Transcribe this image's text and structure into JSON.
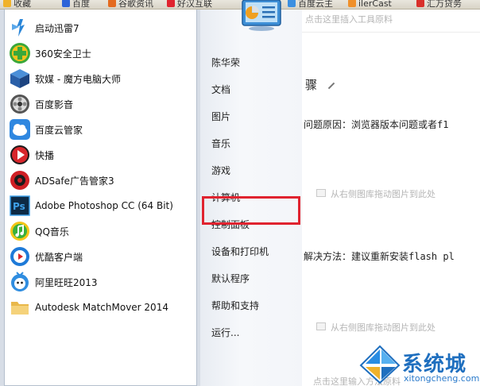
{
  "favorites_bar": {
    "items": [
      {
        "label": "收藏",
        "icon": "star-icon"
      },
      {
        "label": "百度",
        "icon": "baidu-icon"
      },
      {
        "label": "谷歌资讯",
        "icon": "news-icon"
      },
      {
        "label": "好汉互联",
        "icon": "web-icon"
      },
      {
        "label": "百度云主",
        "icon": "cloud-icon"
      },
      {
        "label": "ilerCast",
        "icon": "cast-icon"
      },
      {
        "label": "汇万贷务",
        "icon": "finance-icon"
      }
    ]
  },
  "start_menu": {
    "programs": [
      {
        "label": "启动迅雷7",
        "icon": "thunder-icon"
      },
      {
        "label": "360安全卫士",
        "icon": "360-safe-icon"
      },
      {
        "label": "软媒 - 魔方电脑大师",
        "icon": "rubik-cube-icon"
      },
      {
        "label": "百度影音",
        "icon": "baidu-player-icon"
      },
      {
        "label": "百度云管家",
        "icon": "baidu-cloud-icon"
      },
      {
        "label": "快播",
        "icon": "qvod-icon"
      },
      {
        "label": "ADSafe广告管家3",
        "icon": "adsafe-icon"
      },
      {
        "label": "Adobe Photoshop CC (64 Bit)",
        "icon": "photoshop-icon"
      },
      {
        "label": "QQ音乐",
        "icon": "qq-music-icon"
      },
      {
        "label": "优酷客户端",
        "icon": "youku-icon"
      },
      {
        "label": "阿里旺旺2013",
        "icon": "aliwangwang-icon"
      },
      {
        "label": "Autodesk MatchMover 2014",
        "icon": "folder-icon"
      }
    ],
    "right_items": [
      {
        "label": "陈华荣"
      },
      {
        "label": "文档"
      },
      {
        "label": "图片"
      },
      {
        "label": "音乐"
      },
      {
        "label": "游戏"
      },
      {
        "label": "计算机"
      },
      {
        "label": "控制面板"
      },
      {
        "label": "设备和打印机"
      },
      {
        "label": "默认程序"
      },
      {
        "label": "帮助和支持"
      },
      {
        "label": "运行..."
      }
    ],
    "highlighted_item": "控制面板",
    "highlight_color": "#e0232f"
  },
  "background_page": {
    "top_hint": "点击这里插入工具原料",
    "heading": "骤",
    "problem": "问题原因：浏览器版本问题或者f1",
    "drag_hint_1": "从右侧图库拖动图片到此处",
    "solution": "解决方法：建议重新安装flash pl",
    "drag_hint_2": "从右侧图库拖动图片到此处",
    "bottom_hint": "点击这里输入方法原料"
  },
  "watermark": {
    "name": "系统城",
    "url": "xitongcheng.com",
    "color": "#1f6fbf"
  }
}
